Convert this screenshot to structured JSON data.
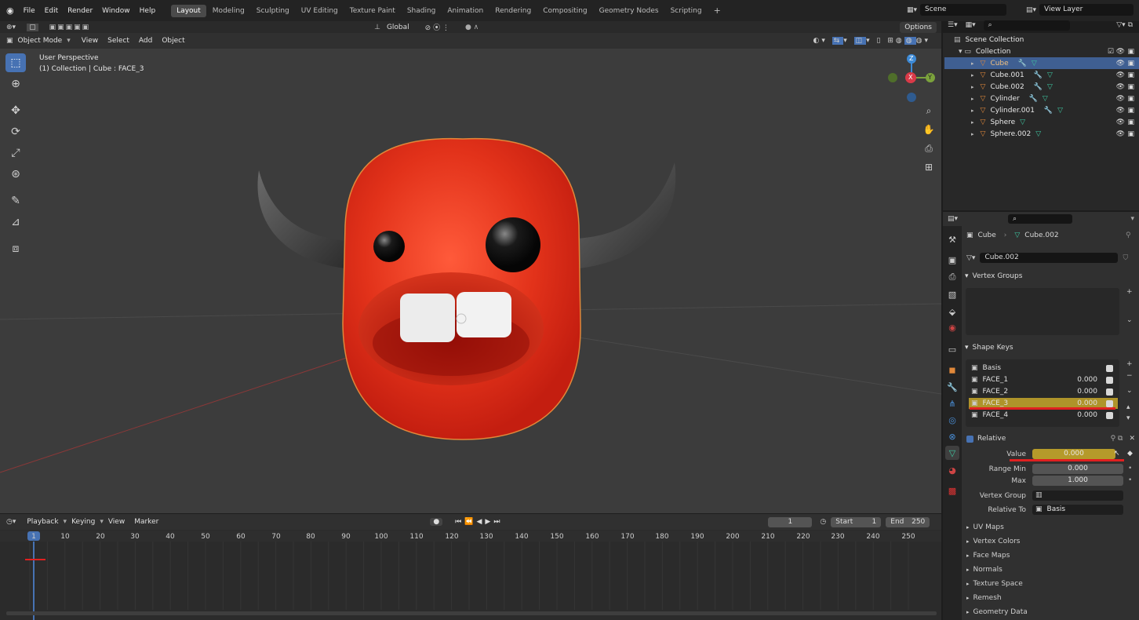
{
  "topbar": {
    "menus": [
      "File",
      "Edit",
      "Render",
      "Window",
      "Help"
    ],
    "workspaces": [
      "Layout",
      "Modeling",
      "Sculpting",
      "UV Editing",
      "Texture Paint",
      "Shading",
      "Animation",
      "Rendering",
      "Compositing",
      "Geometry Nodes",
      "Scripting"
    ],
    "scene": "Scene",
    "view_layer": "View Layer"
  },
  "viewport": {
    "mode": "Object Mode",
    "menus": [
      "View",
      "Select",
      "Add",
      "Object"
    ],
    "orientation": "Global",
    "options": "Options",
    "overlay_title": "User Perspective",
    "overlay_sub": "(1) Collection | Cube : FACE_3",
    "gizmo": {
      "z": "Z",
      "x": "X",
      "y": "Y"
    }
  },
  "timeline": {
    "menus": [
      "Playback",
      "Keying",
      "View",
      "Marker"
    ],
    "current": "1",
    "start_label": "Start",
    "start": "1",
    "end_label": "End",
    "end": "250",
    "ticks": [
      "1",
      "10",
      "20",
      "30",
      "40",
      "50",
      "60",
      "70",
      "80",
      "90",
      "100",
      "110",
      "120",
      "130",
      "140",
      "150",
      "160",
      "170",
      "180",
      "190",
      "200",
      "210",
      "220",
      "230",
      "240",
      "250"
    ]
  },
  "outliner": {
    "root": "Scene Collection",
    "collection": "Collection",
    "items": [
      "Cube",
      "Cube.001",
      "Cube.002",
      "Cylinder",
      "Cylinder.001",
      "Sphere",
      "Sphere.002"
    ]
  },
  "properties": {
    "breadcrumb_obj": "Cube",
    "breadcrumb_mesh": "Cube.002",
    "mesh_name": "Cube.002",
    "vertex_groups": "Vertex Groups",
    "shape_keys": "Shape Keys",
    "keys": [
      {
        "name": "Basis",
        "value": ""
      },
      {
        "name": "FACE_1",
        "value": "0.000"
      },
      {
        "name": "FACE_2",
        "value": "0.000"
      },
      {
        "name": "FACE_3",
        "value": "0.000"
      },
      {
        "name": "FACE_4",
        "value": "0.000"
      }
    ],
    "relative": "Relative",
    "value_label": "Value",
    "value": "0.000",
    "range_min_label": "Range Min",
    "range_min": "0.000",
    "max_label": "Max",
    "max": "1.000",
    "vertex_group_label": "Vertex Group",
    "relative_to_label": "Relative To",
    "relative_to": "Basis",
    "subpanels": [
      "UV Maps",
      "Vertex Colors",
      "Face Maps",
      "Normals",
      "Texture Space",
      "Remesh",
      "Geometry Data"
    ]
  },
  "colors": {
    "selected": "#4772b3",
    "highlight": "#b59a2a",
    "accent_red": "#e02020",
    "mesh_orange": "#e1883a"
  }
}
